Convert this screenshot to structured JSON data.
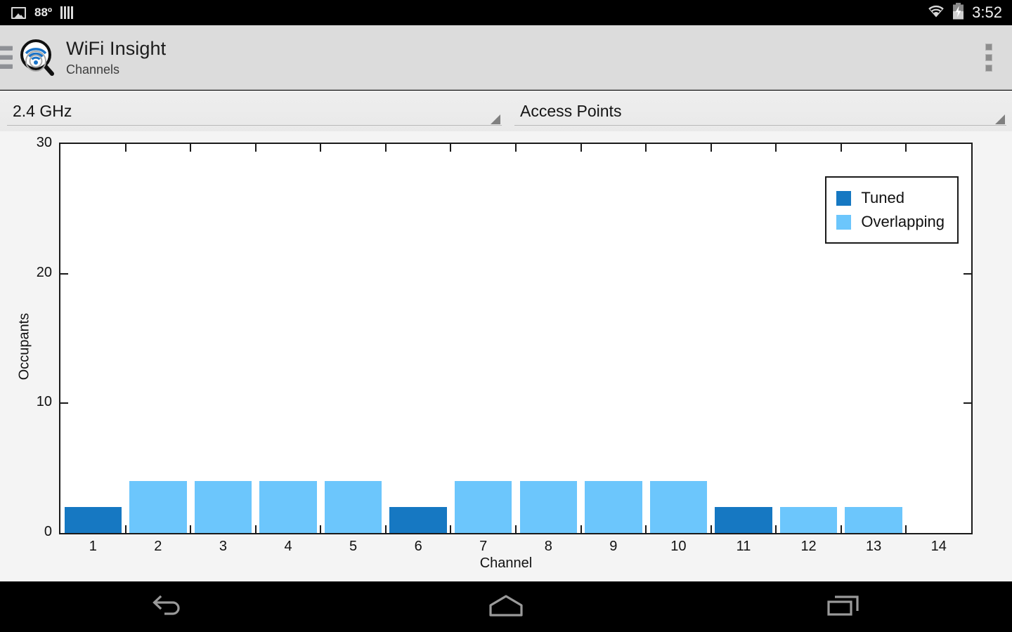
{
  "statusbar": {
    "temperature": "88º",
    "time": "3:52",
    "icons": [
      "photo-icon",
      "signal-bars-icon",
      "wifi-icon",
      "battery-charging-icon"
    ]
  },
  "actionbar": {
    "title": "WiFi Insight",
    "subtitle": "Channels",
    "nav_icon": "hamburger-menu-icon",
    "logo_icon": "wifi-magnifier-logo-icon",
    "overflow_icon": "overflow-menu-icon"
  },
  "spinners": {
    "band": {
      "value": "2.4 GHz"
    },
    "view": {
      "value": "Access Points"
    }
  },
  "navbar": {
    "back": "back-icon",
    "home": "home-icon",
    "recents": "recents-icon"
  },
  "colors": {
    "tuned": "#1678C2",
    "overlapping": "#6CC6FC",
    "axis": "#1a1a1a",
    "plot_bg": "#ffffff",
    "chart_bg": "#f4f4f4"
  },
  "chart_data": {
    "type": "bar",
    "title": "",
    "xlabel": "Channel",
    "ylabel": "Occupants",
    "categories": [
      "1",
      "2",
      "3",
      "4",
      "5",
      "6",
      "7",
      "8",
      "9",
      "10",
      "11",
      "12",
      "13",
      "14"
    ],
    "values": [
      2,
      4,
      4,
      4,
      4,
      2,
      4,
      4,
      4,
      4,
      2,
      2,
      2,
      0
    ],
    "bar_kinds": [
      "tuned",
      "overlapping",
      "overlapping",
      "overlapping",
      "overlapping",
      "tuned",
      "overlapping",
      "overlapping",
      "overlapping",
      "overlapping",
      "tuned",
      "overlapping",
      "overlapping",
      "none"
    ],
    "ylim": [
      0,
      30
    ],
    "yticks": [
      0,
      10,
      20,
      30
    ],
    "ytick_labels": [
      "0",
      "10",
      "20",
      "30"
    ],
    "xlim": [
      0.5,
      14.5
    ],
    "grid": false,
    "legend_position": "top-right",
    "legend": [
      {
        "label": "Tuned",
        "color": "#1678C2"
      },
      {
        "label": "Overlapping",
        "color": "#6CC6FC"
      }
    ]
  }
}
